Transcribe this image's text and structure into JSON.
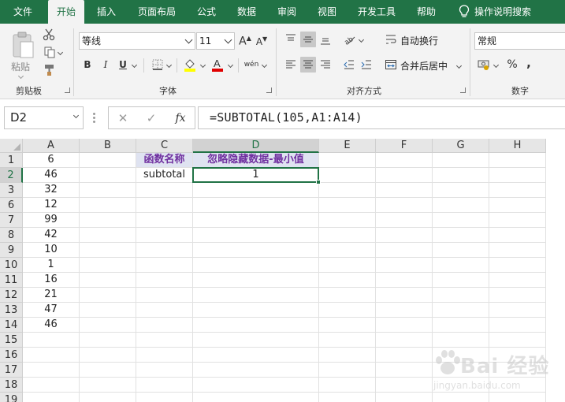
{
  "menu_tabs": [
    {
      "label": "文件"
    },
    {
      "label": "开始",
      "active": true
    },
    {
      "label": "插入"
    },
    {
      "label": "页面布局"
    },
    {
      "label": "公式"
    },
    {
      "label": "数据"
    },
    {
      "label": "审阅"
    },
    {
      "label": "视图"
    },
    {
      "label": "开发工具"
    },
    {
      "label": "帮助"
    }
  ],
  "tell_me": "操作说明搜索",
  "ribbon": {
    "clipboard": {
      "paste_label": "粘贴",
      "group_label": "剪贴板"
    },
    "font": {
      "font_name": "等线",
      "font_size": "11",
      "bold": "B",
      "italic": "I",
      "underline": "U",
      "phonetic": "wén",
      "group_label": "字体"
    },
    "alignment": {
      "wrap_text": "自动换行",
      "merge_center": "合并后居中",
      "group_label": "对齐方式"
    },
    "number": {
      "format": "常规",
      "percent": "%",
      "comma": ",",
      "group_label": "数字"
    }
  },
  "formula_bar": {
    "name_box": "D2",
    "cancel": "✕",
    "enter": "✓",
    "fx": "fx",
    "formula": "=SUBTOTAL(105,A1:A14)"
  },
  "columns": [
    "A",
    "B",
    "C",
    "D",
    "E",
    "F",
    "G",
    "H"
  ],
  "rows": [
    {
      "num": "1",
      "A": "6",
      "C": "函数名称",
      "D": "忽略隐藏数据-最小值"
    },
    {
      "num": "2",
      "A": "46",
      "C": "subtotal",
      "D": "1"
    },
    {
      "num": "3",
      "A": "32"
    },
    {
      "num": "6",
      "A": "12"
    },
    {
      "num": "7",
      "A": "99"
    },
    {
      "num": "8",
      "A": "42"
    },
    {
      "num": "9",
      "A": "10"
    },
    {
      "num": "10",
      "A": "1"
    },
    {
      "num": "11",
      "A": "16"
    },
    {
      "num": "12",
      "A": "21"
    },
    {
      "num": "13",
      "A": "47"
    },
    {
      "num": "14",
      "A": "46"
    },
    {
      "num": "15"
    },
    {
      "num": "16"
    },
    {
      "num": "17"
    },
    {
      "num": "18"
    },
    {
      "num": "19"
    }
  ],
  "active_cell": "D2",
  "colors": {
    "accent": "#217346",
    "header_text": "#7030a0",
    "header_fill": "#dfe3f1"
  },
  "watermark": {
    "main": "Bai 经验",
    "sub": "jingyan.baidu.com"
  }
}
